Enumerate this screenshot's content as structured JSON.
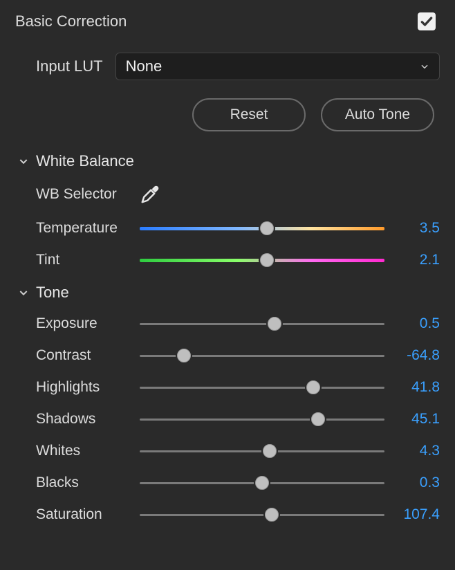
{
  "header": {
    "title": "Basic Correction",
    "enabled": true
  },
  "input_lut": {
    "label": "Input LUT",
    "value": "None"
  },
  "buttons": {
    "reset": "Reset",
    "auto_tone": "Auto Tone"
  },
  "white_balance": {
    "title": "White Balance",
    "selector_label": "WB Selector",
    "temperature": {
      "label": "Temperature",
      "value": "3.5",
      "pos": 52
    },
    "tint": {
      "label": "Tint",
      "value": "2.1",
      "pos": 52
    }
  },
  "tone": {
    "title": "Tone",
    "exposure": {
      "label": "Exposure",
      "value": "0.5",
      "pos": 55
    },
    "contrast": {
      "label": "Contrast",
      "value": "-64.8",
      "pos": 18
    },
    "highlights": {
      "label": "Highlights",
      "value": "41.8",
      "pos": 71
    },
    "shadows": {
      "label": "Shadows",
      "value": "45.1",
      "pos": 73
    },
    "whites": {
      "label": "Whites",
      "value": "4.3",
      "pos": 53
    },
    "blacks": {
      "label": "Blacks",
      "value": "0.3",
      "pos": 50
    },
    "saturation": {
      "label": "Saturation",
      "value": "107.4",
      "pos": 54
    }
  }
}
